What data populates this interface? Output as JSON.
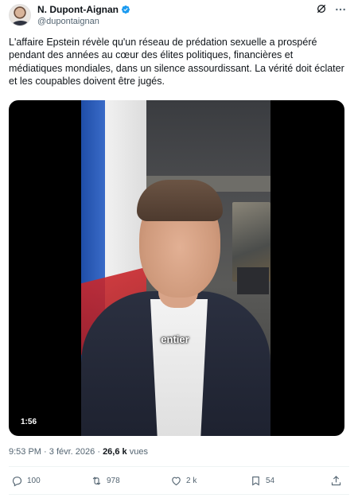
{
  "author": {
    "display_name": "N. Dupont-Aignan",
    "handle": "@dupontaignan",
    "verified_color": "#1d9bf0"
  },
  "tweet": {
    "text": "L'affaire Epstein révèle qu'un réseau de prédation sexuelle a prospéré pendant des années au cœur des élites politiques, financières et médiatiques mondiales, dans un silence assourdissant. La vérité doit éclater et les coupables doivent être jugés."
  },
  "video": {
    "caption": "entier",
    "duration": "1:56"
  },
  "meta": {
    "time": "9:53 PM",
    "separator": "·",
    "date": "3 févr. 2026",
    "views_count": "26,6 k",
    "views_label": "vues"
  },
  "actions": {
    "replies": "100",
    "reposts": "978",
    "likes": "2 k",
    "bookmarks": "54"
  },
  "colors": {
    "text_primary": "#0f1419",
    "text_secondary": "#536471",
    "divider": "#eff3f4"
  }
}
